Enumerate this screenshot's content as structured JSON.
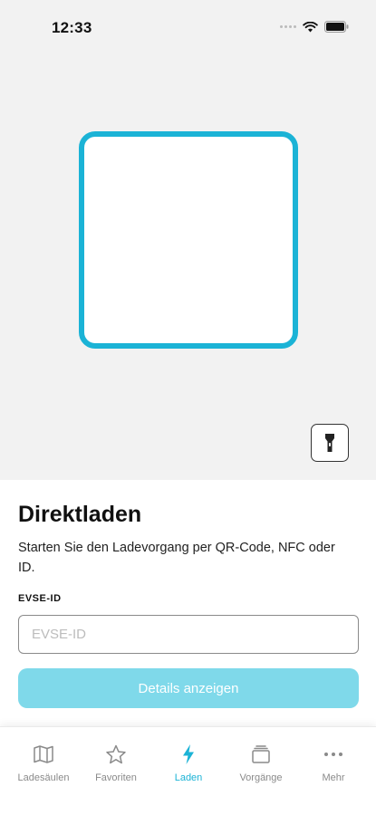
{
  "status_bar": {
    "time": "12:33"
  },
  "camera": {
    "flashlight_icon": "flashlight-icon"
  },
  "direct_charge": {
    "title": "Direktladen",
    "description": "Starten Sie den Ladevorgang per QR-Code, NFC oder ID.",
    "field_label": "EVSE-ID",
    "field_value": "",
    "field_placeholder": "EVSE-ID",
    "button_label": "Details anzeigen"
  },
  "tab_bar": {
    "tabs": [
      {
        "label": "Ladesäulen",
        "icon": "map-icon",
        "active": false
      },
      {
        "label": "Favoriten",
        "icon": "star-icon",
        "active": false
      },
      {
        "label": "Laden",
        "icon": "lightning-icon",
        "active": true
      },
      {
        "label": "Vorgänge",
        "icon": "stack-icon",
        "active": false
      },
      {
        "label": "Mehr",
        "icon": "more-icon",
        "active": false
      }
    ]
  },
  "colors": {
    "accent": "#1bb3d6",
    "button_disabled": "#7fd9ea",
    "inactive_tab": "#8a8a8a"
  }
}
